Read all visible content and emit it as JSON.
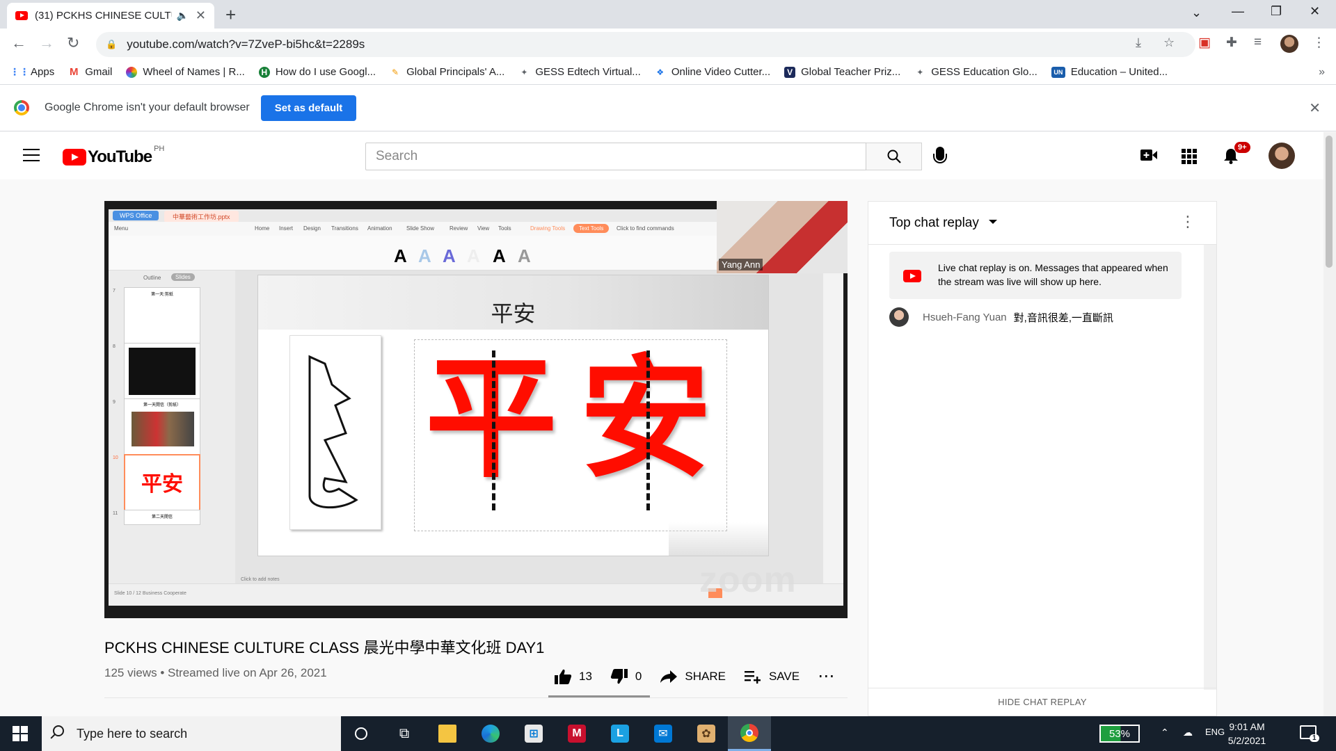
{
  "browser": {
    "tab_title": "(31) PCKHS CHINESE CULTU",
    "url": "youtube.com/watch?v=7ZveP-bi5hc&t=2289s",
    "bookmarks": [
      {
        "label": "Apps",
        "icon": "apps-grid-icon",
        "color": "#4285f4"
      },
      {
        "label": "Gmail",
        "icon": "gmail-icon",
        "color": "#ea4335"
      },
      {
        "label": "Wheel of Names | R...",
        "icon": "wheel-icon",
        "color": "#9c27b0"
      },
      {
        "label": "How do I use Googl...",
        "icon": "h-icon",
        "color": "#188038"
      },
      {
        "label": "Global Principals' A...",
        "icon": "globe-icon",
        "color": "#f29900"
      },
      {
        "label": "GESS Edtech Virtual...",
        "icon": "gess-icon",
        "color": "#5f6368"
      },
      {
        "label": "Online Video Cutter...",
        "icon": "cutter-icon",
        "color": "#1a73e8"
      },
      {
        "label": "Global Teacher Priz...",
        "icon": "v-icon",
        "color": "#1c2a5a"
      },
      {
        "label": "GESS Education Glo...",
        "icon": "gess-icon",
        "color": "#5f6368"
      },
      {
        "label": "Education – United...",
        "icon": "un-icon",
        "color": "#1a5dab"
      }
    ],
    "infobar_message": "Google Chrome isn't your default browser",
    "set_default_label": "Set as default"
  },
  "youtube": {
    "logo_text": "YouTube",
    "country_code": "PH",
    "search_placeholder": "Search",
    "notification_badge": "9+"
  },
  "player": {
    "wps_brand": "WPS Office",
    "wps_doc": "中華藝術工作坊.pptx",
    "menu": [
      "Menu",
      "Home",
      "Insert",
      "Design",
      "Transitions",
      "Animation",
      "Slide Show",
      "Review",
      "View",
      "Tools",
      "Drawing Tools",
      "Text Tools",
      "Click to find commands"
    ],
    "slide_title": "平安",
    "slide_chars": [
      "平",
      "安"
    ],
    "thumb_nums": [
      "7",
      "8",
      "9",
      "10",
      "11"
    ],
    "thumb_labels": [
      "第一天:剪紙",
      "",
      "第一天開信（剪紙）",
      "平安",
      "第二天開信"
    ],
    "status_left": "Slide 10 / 12    Business Cooperate",
    "notes_placeholder": "Click to add notes",
    "outline_tab": "Outline",
    "slides_tab": "Slides",
    "camera_name": "Yang Ann",
    "zoom_watermark": "zoom"
  },
  "video": {
    "title": "PCKHS CHINESE CULTURE CLASS 晨光中學中華文化班 DAY1",
    "meta": "125 views • Streamed live on Apr 26, 2021",
    "likes": "13",
    "dislikes": "0",
    "share_label": "SHARE",
    "save_label": "SAVE"
  },
  "chat": {
    "header": "Top chat replay",
    "notice": "Live chat replay is on. Messages that appeared when the stream was live will show up here.",
    "messages": [
      {
        "author": "Hsueh-Fang Yuan",
        "text": "對,音訊很差,一直斷訊"
      }
    ],
    "hide_label": "HIDE CHAT REPLAY"
  },
  "taskbar": {
    "search_placeholder": "Type here to search",
    "battery": "53%",
    "language": "ENG",
    "time": "9:01 AM",
    "date": "5/2/2021",
    "notification_count": "1"
  }
}
